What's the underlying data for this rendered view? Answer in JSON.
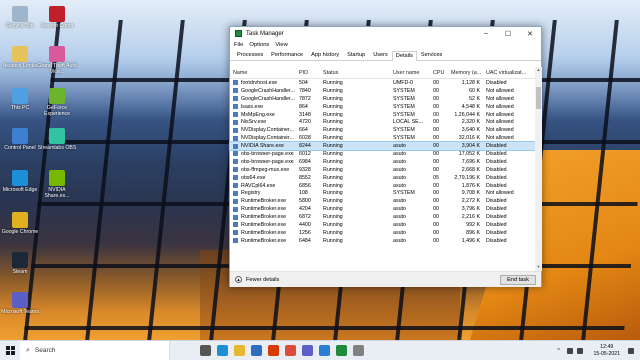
{
  "desktop": {
    "icons": [
      {
        "label": "Recycle Bin",
        "icon": "recycle-bin-icon",
        "color": "#9fb5cc"
      },
      {
        "label": "Assetto Corsa",
        "icon": "assetto-corsa-icon",
        "color": "#c0202a"
      },
      {
        "label": "Asutosh Lenka",
        "icon": "user-folder-icon",
        "color": "#e6c25a"
      },
      {
        "label": "Grand Theft Auto Vice...",
        "icon": "gta-icon",
        "color": "#d85a9a"
      },
      {
        "label": "This PC",
        "icon": "this-pc-icon",
        "color": "#4fa0e0"
      },
      {
        "label": "GeForce Experience",
        "icon": "geforce-icon",
        "color": "#6cb42c"
      },
      {
        "label": "Control Panel",
        "icon": "control-panel-icon",
        "color": "#3d7fd0"
      },
      {
        "label": "Streamlabs OBS",
        "icon": "streamlabs-icon",
        "color": "#31c3a2"
      },
      {
        "label": "Microsoft Edge",
        "icon": "edge-icon",
        "color": "#1c8fd6"
      },
      {
        "label": "NVIDIA Share.ex...",
        "icon": "nvidia-share-icon",
        "color": "#76b900"
      },
      {
        "label": "Google Chrome",
        "icon": "chrome-icon",
        "color": "#e0b020"
      },
      {
        "label": "Steam",
        "icon": "steam-icon",
        "color": "#1b2838"
      },
      {
        "label": "Microsoft Teams",
        "icon": "teams-icon",
        "color": "#5b5fc7"
      }
    ]
  },
  "window": {
    "title": "Task Manager",
    "minimize": "–",
    "maximize": "☐",
    "close": "✕",
    "menu": [
      "File",
      "Options",
      "View"
    ],
    "tabs": [
      "Processes",
      "Performance",
      "App history",
      "Startup",
      "Users",
      "Details",
      "Services"
    ],
    "active_tab": "Details",
    "columns": [
      "Name",
      "PID",
      "Status",
      "User name",
      "CPU",
      "Memory (a...",
      "UAC virtualizat..."
    ],
    "rows": [
      [
        "fontdrvhost.exe",
        "504",
        "Running",
        "UMFD-0",
        "00",
        "1,128 K",
        "Disabled"
      ],
      [
        "GoogleCrashHandler...",
        "7840",
        "Running",
        "SYSTEM",
        "00",
        "60 K",
        "Not allowed"
      ],
      [
        "GoogleCrashHandler...",
        "7872",
        "Running",
        "SYSTEM",
        "00",
        "52 K",
        "Not allowed"
      ],
      [
        "lsass.exe",
        "864",
        "Running",
        "SYSTEM",
        "00",
        "4,548 K",
        "Not allowed"
      ],
      [
        "MsMpEng.exe",
        "3148",
        "Running",
        "SYSTEM",
        "00",
        "1,26,044 K",
        "Not allowed"
      ],
      [
        "NisSrv.exe",
        "4720",
        "Running",
        "LOCAL SE...",
        "00",
        "2,320 K",
        "Not allowed"
      ],
      [
        "NVDisplay.Container...",
        "664",
        "Running",
        "SYSTEM",
        "00",
        "3,640 K",
        "Not allowed"
      ],
      [
        "NVDisplay.Container...",
        "6028",
        "Running",
        "SYSTEM",
        "00",
        "32,016 K",
        "Not allowed"
      ],
      [
        "NVIDIA Share.exe",
        "8244",
        "Running",
        "asuto",
        "00",
        "3,904 K",
        "Disabled"
      ],
      [
        "obs-browser-page.exe",
        "6012",
        "Running",
        "asuto",
        "00",
        "17,052 K",
        "Disabled"
      ],
      [
        "obs-browser-page.exe",
        "6984",
        "Running",
        "asuto",
        "00",
        "7,696 K",
        "Disabled"
      ],
      [
        "obs-ffmpeg-mux.exe",
        "9328",
        "Running",
        "asuto",
        "00",
        "2,668 K",
        "Disabled"
      ],
      [
        "obs64.exe",
        "8552",
        "Running",
        "asuto",
        "05",
        "2,79,196 K",
        "Disabled"
      ],
      [
        "RAVCpl64.exe",
        "6856",
        "Running",
        "asuto",
        "00",
        "1,876 K",
        "Disabled"
      ],
      [
        "Registry",
        "108",
        "Running",
        "SYSTEM",
        "00",
        "9,708 K",
        "Not allowed"
      ],
      [
        "RuntimeBroker.exe",
        "5800",
        "Running",
        "asuto",
        "00",
        "2,272 K",
        "Disabled"
      ],
      [
        "RuntimeBroker.exe",
        "4204",
        "Running",
        "asuto",
        "00",
        "3,796 K",
        "Disabled"
      ],
      [
        "RuntimeBroker.exe",
        "6872",
        "Running",
        "asuto",
        "00",
        "2,216 K",
        "Disabled"
      ],
      [
        "RuntimeBroker.exe",
        "4400",
        "Running",
        "asuto",
        "00",
        "992 K",
        "Disabled"
      ],
      [
        "RuntimeBroker.exe",
        "1256",
        "Running",
        "asuto",
        "00",
        "896 K",
        "Disabled"
      ],
      [
        "RuntimeBroker.exe",
        "6484",
        "Running",
        "asuto",
        "00",
        "1,496 K",
        "Disabled"
      ]
    ],
    "selected_row": 8,
    "fewer_details": "Fewer details",
    "end_task": "End task"
  },
  "taskbar": {
    "search_placeholder": "Search",
    "apps": [
      {
        "icon": "task-view-icon",
        "color": "#555555"
      },
      {
        "icon": "edge-icon",
        "color": "#1c8fd6"
      },
      {
        "icon": "file-explorer-icon",
        "color": "#e8b730"
      },
      {
        "icon": "store-icon",
        "color": "#2d6cc0"
      },
      {
        "icon": "office-icon",
        "color": "#d83b01"
      },
      {
        "icon": "chrome-icon",
        "color": "#dd4b39"
      },
      {
        "icon": "teams-icon",
        "color": "#5b5fc7"
      },
      {
        "icon": "taskbar-app-icon",
        "color": "#2a7fd4"
      },
      {
        "icon": "task-manager-icon",
        "color": "#1f8a3a"
      },
      {
        "icon": "taskbar-app-icon",
        "color": "#808080"
      }
    ],
    "time": "12:49",
    "date": "15-05-2021"
  }
}
